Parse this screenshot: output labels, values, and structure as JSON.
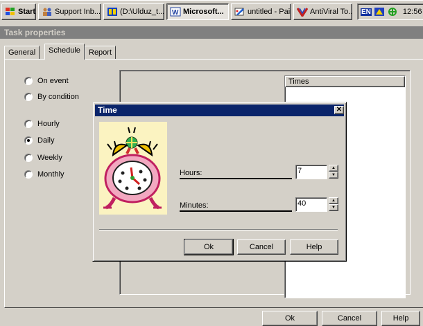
{
  "taskbar": {
    "start_label": "Start",
    "buttons": [
      {
        "label": "Support Inb..."
      },
      {
        "label": "(D:\\Ulduz_t..."
      },
      {
        "label": "Microsoft..."
      },
      {
        "label": "untitled - Paint"
      },
      {
        "label": "AntiViral To..."
      }
    ],
    "lang": "EN",
    "clock": "12:56"
  },
  "task_window": {
    "title": "Task properties",
    "tabs": [
      {
        "label": "General"
      },
      {
        "label": "Schedule"
      },
      {
        "label": "Report"
      }
    ],
    "trigger_options": [
      {
        "label": "On event",
        "selected": false
      },
      {
        "label": "By condition",
        "selected": false
      }
    ],
    "frequency_options": [
      {
        "label": "Hourly",
        "selected": false
      },
      {
        "label": "Daily",
        "selected": true
      },
      {
        "label": "Weekly",
        "selected": false
      },
      {
        "label": "Monthly",
        "selected": false
      }
    ],
    "times_header": "Times",
    "buttons": {
      "ok": "Ok",
      "cancel": "Cancel",
      "help": "Help"
    }
  },
  "time_dialog": {
    "title": "Time",
    "close_glyph": "✕",
    "hours_label": "Hours:",
    "hours_value": "7",
    "minutes_label": "Minutes:",
    "minutes_value": "40",
    "buttons": {
      "ok": "Ok",
      "cancel": "Cancel",
      "help": "Help"
    }
  }
}
